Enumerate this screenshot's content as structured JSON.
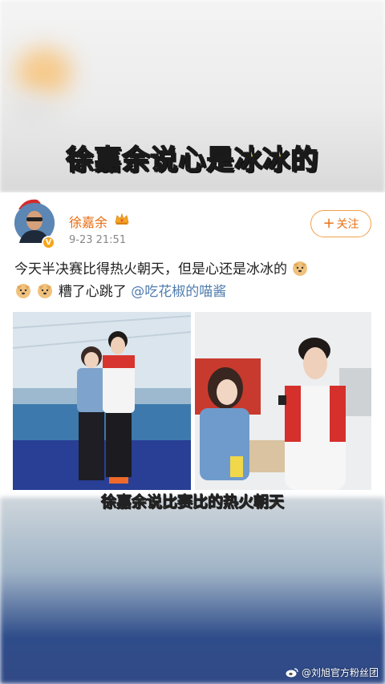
{
  "banner": {
    "title": "徐嘉余说心是冰冰的"
  },
  "post": {
    "username": "徐嘉余",
    "timestamp": "9-23 21:51",
    "follow_label": "关注",
    "text_part1": "今天半决赛比得热火朝天，但是心还是冰冰的",
    "text_part2": "糟了心跳了",
    "mention": "@吃花椒的喵酱",
    "username_color": "#e86b10",
    "mention_color": "#507daf"
  },
  "caption": {
    "text": "徐嘉余说比赛比的热火朝天"
  },
  "watermark": {
    "text": "@刘旭官方粉丝团"
  },
  "icons": {
    "crown": "crown-icon",
    "verified": "verified-badge-icon",
    "emoji": "doge-emoji-icon",
    "weibo": "weibo-logo-icon"
  }
}
